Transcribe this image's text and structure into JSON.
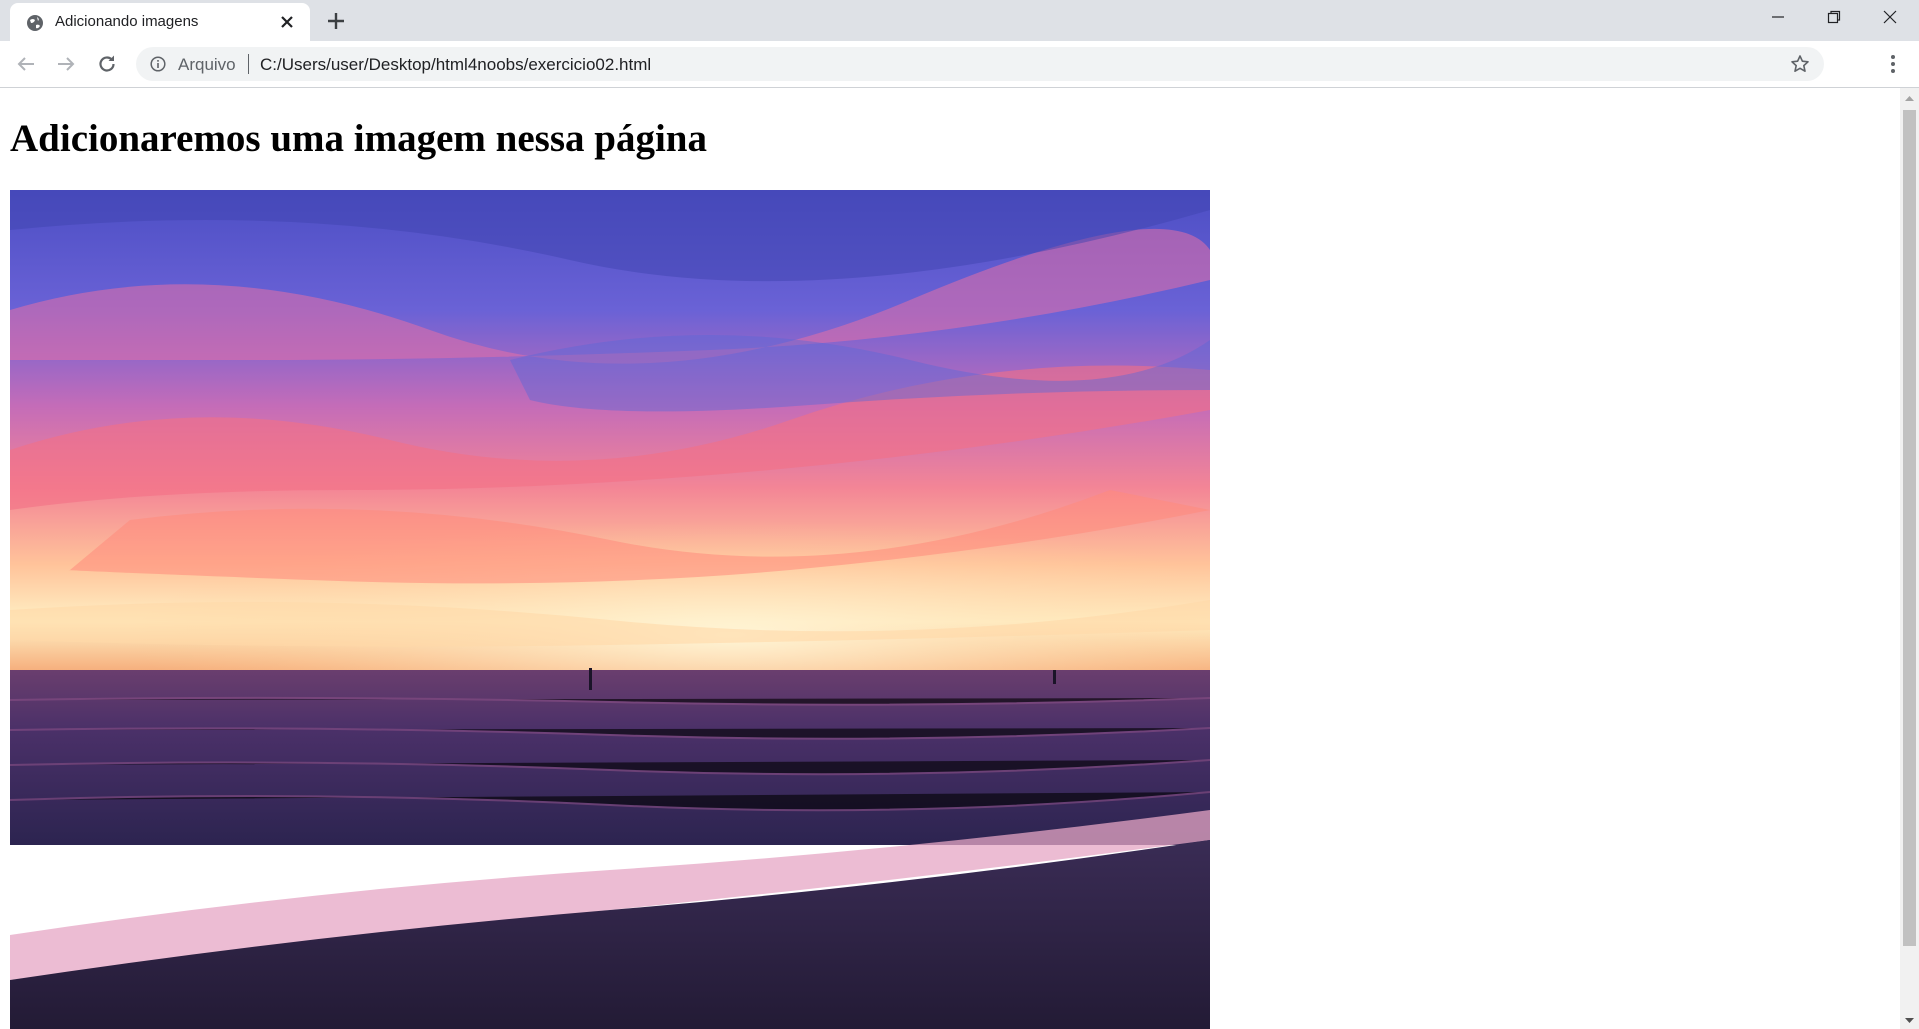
{
  "browser": {
    "tab": {
      "title": "Adicionando imagens",
      "favicon": "globe-icon"
    },
    "address_bar": {
      "scheme_label": "Arquivo",
      "url": "C:/Users/user/Desktop/html4noobs/exercicio02.html"
    },
    "icons": {
      "back": "back-arrow-icon",
      "forward": "forward-arrow-icon",
      "reload": "reload-icon",
      "info": "info-icon",
      "bookmark": "star-icon",
      "menu": "kebab-menu-icon",
      "new_tab": "plus-icon",
      "close_tab": "close-icon"
    }
  },
  "page": {
    "heading": "Adicionaremos uma imagem nessa página",
    "image": {
      "subject": "beach sunset with pink and purple clouds over the sea"
    }
  },
  "colors": {
    "tabstrip": "#dee1e6",
    "omnibox": "#f1f3f4",
    "sky_top": "#5a5fd0",
    "sky_mid": "#f07a9a",
    "horizon": "#ffe8b0",
    "sea": "#3a2a5e",
    "sand": "#2b2240"
  }
}
